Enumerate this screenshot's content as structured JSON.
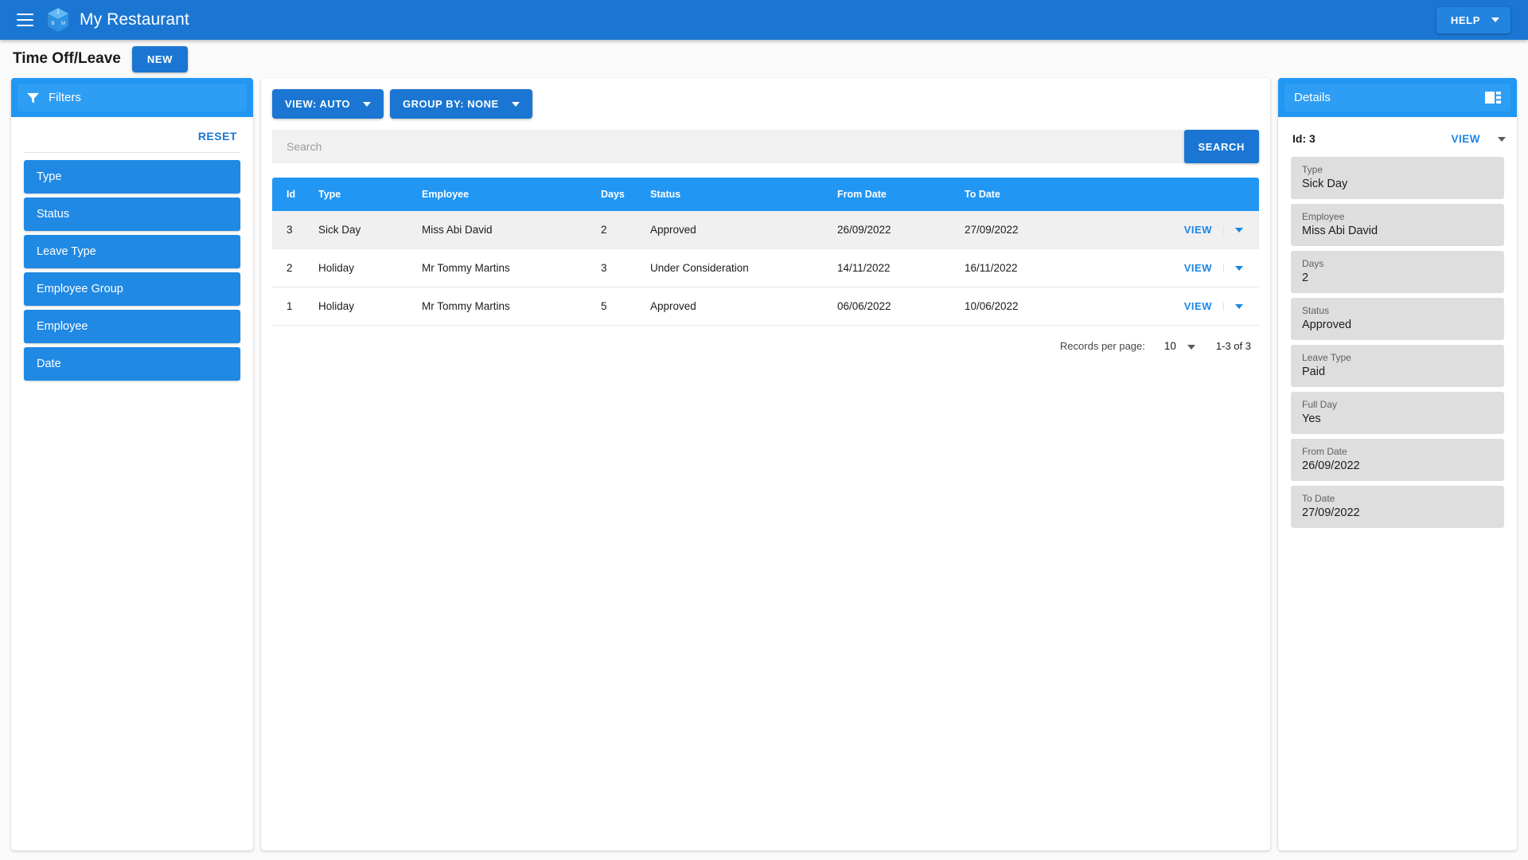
{
  "appbar": {
    "title": "My Restaurant",
    "help_label": "HELP",
    "logo_badge": "1",
    "logo_letters": [
      "B",
      "M"
    ]
  },
  "pagebar": {
    "title": "Time Off/Leave",
    "new_label": "NEW"
  },
  "filters": {
    "header": "Filters",
    "reset_label": "RESET",
    "items": [
      {
        "label": "Type"
      },
      {
        "label": "Status"
      },
      {
        "label": "Leave Type"
      },
      {
        "label": "Employee Group"
      },
      {
        "label": "Employee"
      },
      {
        "label": "Date"
      }
    ]
  },
  "toolbar": {
    "view_label": "VIEW: AUTO",
    "group_by_label": "GROUP BY: NONE"
  },
  "search": {
    "value": "",
    "placeholder": "Search",
    "button_label": "SEARCH"
  },
  "table": {
    "columns": [
      "Id",
      "Type",
      "Employee",
      "Days",
      "Status",
      "From Date",
      "To Date",
      ""
    ],
    "row_action_label": "VIEW",
    "rows": [
      {
        "id": "3",
        "type": "Sick Day",
        "employee": "Miss Abi David",
        "days": "2",
        "status": "Approved",
        "from_date": "26/09/2022",
        "to_date": "27/09/2022",
        "selected": true
      },
      {
        "id": "2",
        "type": "Holiday",
        "employee": "Mr Tommy Martins",
        "days": "3",
        "status": "Under Consideration",
        "from_date": "14/11/2022",
        "to_date": "16/11/2022",
        "selected": false
      },
      {
        "id": "1",
        "type": "Holiday",
        "employee": "Mr Tommy Martins",
        "days": "5",
        "status": "Approved",
        "from_date": "06/06/2022",
        "to_date": "10/06/2022",
        "selected": false
      }
    ]
  },
  "pager": {
    "records_per_page_label": "Records per page:",
    "records_per_page_value": "10",
    "range_label": "1-3 of 3"
  },
  "details": {
    "header": "Details",
    "id_label": "Id: 3",
    "view_label": "VIEW",
    "fields": [
      {
        "label": "Type",
        "value": "Sick Day"
      },
      {
        "label": "Employee",
        "value": "Miss Abi David"
      },
      {
        "label": "Days",
        "value": "2"
      },
      {
        "label": "Status",
        "value": "Approved"
      },
      {
        "label": "Leave Type",
        "value": "Paid"
      },
      {
        "label": "Full Day",
        "value": "Yes"
      },
      {
        "label": "From Date",
        "value": "26/09/2022"
      },
      {
        "label": "To Date",
        "value": "27/09/2022"
      }
    ]
  },
  "colors": {
    "appbar_blue": "#1a76d2",
    "accent_blue": "#2196f3",
    "link_blue": "#1a86e8",
    "field_gray": "#dedede"
  }
}
